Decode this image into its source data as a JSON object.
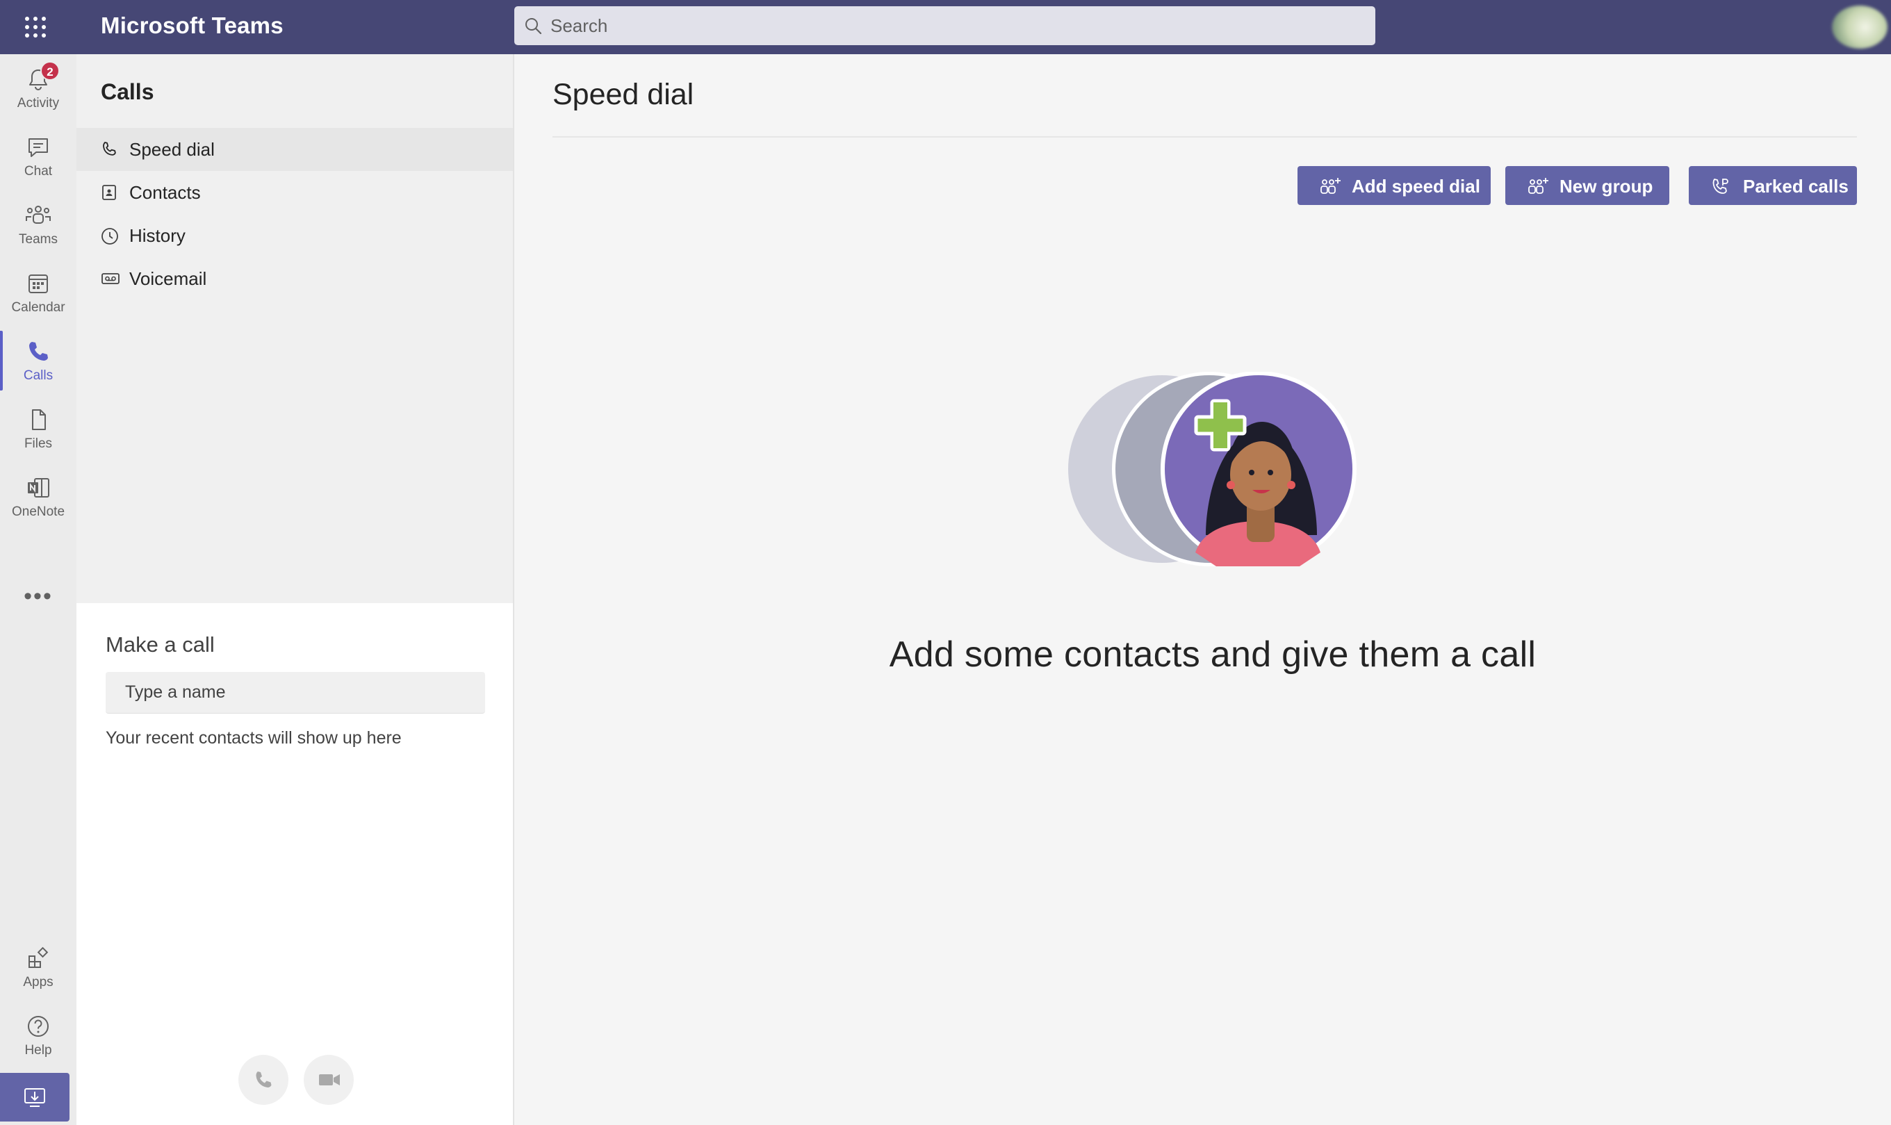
{
  "app": {
    "title": "Microsoft Teams"
  },
  "search": {
    "placeholder": "Search"
  },
  "rail": {
    "items": [
      {
        "label": "Activity",
        "badge": "2"
      },
      {
        "label": "Chat"
      },
      {
        "label": "Teams"
      },
      {
        "label": "Calendar"
      },
      {
        "label": "Calls"
      },
      {
        "label": "Files"
      },
      {
        "label": "OneNote"
      }
    ],
    "more": "•••",
    "bottom": [
      {
        "label": "Apps"
      },
      {
        "label": "Help"
      }
    ]
  },
  "calls_panel": {
    "title": "Calls",
    "items": [
      {
        "label": "Speed dial",
        "icon": "phone-icon"
      },
      {
        "label": "Contacts",
        "icon": "contact-card-icon"
      },
      {
        "label": "History",
        "icon": "clock-icon"
      },
      {
        "label": "Voicemail",
        "icon": "voicemail-icon"
      }
    ]
  },
  "make_call": {
    "title": "Make a call",
    "input_placeholder": "Type a name",
    "recent_text": "Your recent contacts will show up here"
  },
  "main": {
    "title": "Speed dial",
    "buttons": [
      {
        "label": "Add speed dial",
        "icon": "add-people-icon"
      },
      {
        "label": "New group",
        "icon": "add-people-icon"
      },
      {
        "label": "Parked calls",
        "icon": "parked-call-icon"
      }
    ],
    "empty_message": "Add some contacts and give them a call"
  },
  "colors": {
    "topbar": "#464775",
    "accent": "#6264a7",
    "active": "#5b5fc7",
    "badge": "#c4314b",
    "illustration_purple": "#7b6ab8",
    "illustration_plus": "#8fc04c"
  }
}
